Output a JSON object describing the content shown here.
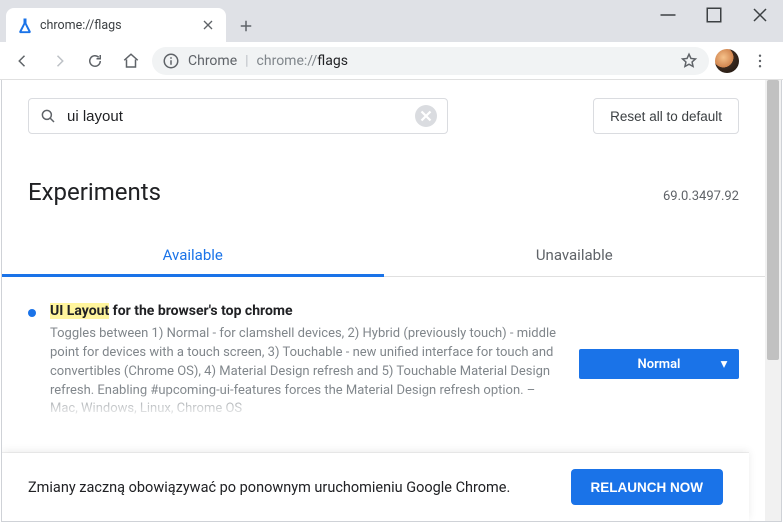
{
  "window": {
    "tab_title": "chrome://flags"
  },
  "navbar": {
    "origin_label": "Chrome",
    "url_prefix": "chrome://",
    "url_path": "flags"
  },
  "search": {
    "value": "ui layout",
    "reset_label": "Reset all to default"
  },
  "page": {
    "title": "Experiments",
    "version": "69.0.3497.92",
    "tabs": [
      {
        "label": "Available",
        "active": true
      },
      {
        "label": "Unavailable",
        "active": false
      }
    ]
  },
  "flag": {
    "title_highlight": "UI Layout",
    "title_rest": " for the browser's top chrome",
    "description": "Toggles between 1) Normal - for clamshell devices, 2) Hybrid (previously touch) - middle point for devices with a touch screen, 3) Touchable - new unified interface for touch and convertibles (Chrome OS), 4) Material Design refresh and 5) Touchable Material Design refresh. Enabling #upcoming-ui-features forces the Material Design refresh option. – Mac, Windows, Linux, Chrome OS",
    "selected_option": "Normal"
  },
  "relaunch": {
    "message": "Zmiany zaczną obowiązywać po ponownym uruchomieniu Google Chrome.",
    "button_label": "RELAUNCH NOW"
  }
}
